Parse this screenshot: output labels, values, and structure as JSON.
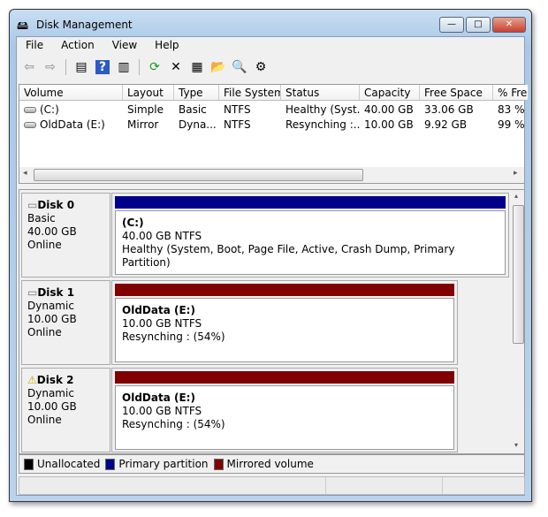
{
  "window": {
    "title": "Disk Management",
    "controls": {
      "minimize": "—",
      "maximize": "□",
      "close": "✕"
    },
    "close_color": "#c84030"
  },
  "menu": [
    "File",
    "Action",
    "View",
    "Help"
  ],
  "toolbar": [
    {
      "icon": "back-arrow-icon",
      "glyph": "⇦"
    },
    {
      "icon": "forward-arrow-icon",
      "glyph": "⇨"
    },
    {
      "icon": "show-hide-console-tree-icon",
      "glyph": "▤"
    },
    {
      "icon": "help-icon",
      "glyph": "?"
    },
    {
      "icon": "show-hide-action-pane-icon",
      "glyph": "▥"
    },
    {
      "icon": "refresh-icon",
      "glyph": "⟳"
    },
    {
      "icon": "delete-icon",
      "glyph": "✕"
    },
    {
      "icon": "properties-icon",
      "glyph": "▦"
    },
    {
      "icon": "open-folder-icon",
      "glyph": "📂"
    },
    {
      "icon": "explore-icon",
      "glyph": "🔍"
    },
    {
      "icon": "settings-icon",
      "glyph": "⚙"
    }
  ],
  "volumes": {
    "columns": [
      "Volume",
      "Layout",
      "Type",
      "File System",
      "Status",
      "Capacity",
      "Free Space",
      "% Fre"
    ],
    "rows": [
      [
        "(C:)",
        "Simple",
        "Basic",
        "NTFS",
        "Healthy (Syst...",
        "40.00 GB",
        "33.06 GB",
        "83 %"
      ],
      [
        "OldData (E:)",
        "Mirror",
        "Dyna...",
        "NTFS",
        "Resynching :...",
        "10.00 GB",
        "9.92 GB",
        "99 %"
      ]
    ]
  },
  "disks": [
    {
      "name": "Disk 0",
      "type": "Basic",
      "size": "40.00 GB",
      "state": "Online",
      "warning": false,
      "part": {
        "title": "(C:)",
        "size": "40.00 GB NTFS",
        "status": "Healthy (System, Boot, Page File, Active, Crash Dump, Primary Partition)",
        "color": "#00008b"
      }
    },
    {
      "name": "Disk 1",
      "type": "Dynamic",
      "size": "10.00 GB",
      "state": "Online",
      "warning": false,
      "part": {
        "title": "OldData  (E:)",
        "size": "10.00 GB NTFS",
        "status": "Resynching : (54%)",
        "color": "#800000"
      }
    },
    {
      "name": "Disk 2",
      "type": "Dynamic",
      "size": "10.00 GB",
      "state": "Online",
      "warning": true,
      "part": {
        "title": "OldData  (E:)",
        "size": "10.00 GB NTFS",
        "status": "Resynching : (54%)",
        "color": "#800000"
      }
    }
  ],
  "legend": [
    {
      "label": "Unallocated",
      "color": "#000000"
    },
    {
      "label": "Primary partition",
      "color": "#00008b"
    },
    {
      "label": "Mirrored volume",
      "color": "#800000"
    }
  ]
}
